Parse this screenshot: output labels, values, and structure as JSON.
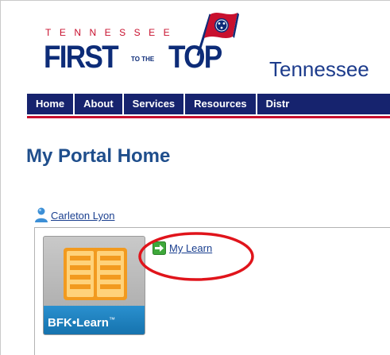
{
  "header": {
    "logo": {
      "tennessee_text": "TENNESSEE",
      "first_text": "FIRST",
      "to_the_text": "TO THE",
      "top_text": "TOP"
    },
    "state_name": "Tennessee"
  },
  "nav": {
    "items": [
      {
        "label": "Home"
      },
      {
        "label": "About"
      },
      {
        "label": "Services"
      },
      {
        "label": "Resources"
      },
      {
        "label": "Distr"
      }
    ]
  },
  "main": {
    "title": "My Portal Home",
    "user": {
      "name": "Carleton Lyon",
      "icon": "user-icon"
    },
    "apps": [
      {
        "tile_label": "BFK•Learn",
        "trademark": "™",
        "link_label": "My Learn",
        "link_icon": "green-arrow-icon"
      }
    ]
  },
  "colors": {
    "nav_background": "#16236e",
    "nav_underline": "#c8102e",
    "title_blue": "#1f4e8c",
    "link_blue": "#1a3f8f",
    "highlight_red": "#e0141b",
    "tile_blue": "#1f84c4"
  }
}
